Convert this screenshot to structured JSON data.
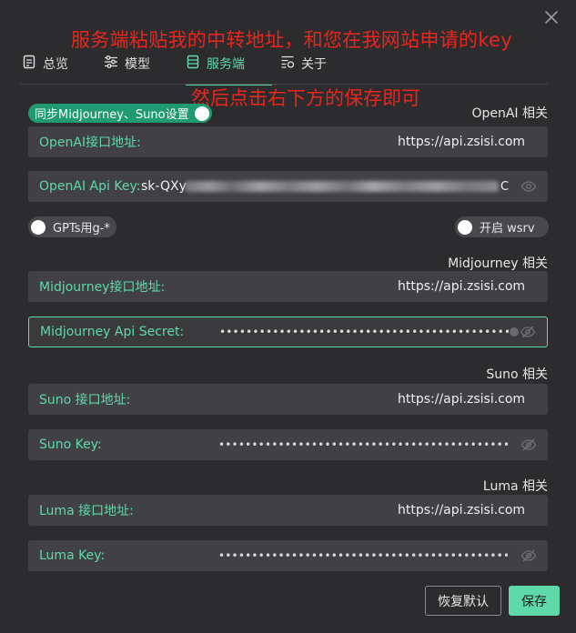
{
  "annotation": {
    "line1": "服务端粘贴我的中转地址，和您在我网站申请的key",
    "line2": "然后点击右下方的保存即可"
  },
  "tabs": [
    {
      "label": "总览",
      "icon": "summary-icon"
    },
    {
      "label": "模型",
      "icon": "sliders-icon"
    },
    {
      "label": "服务端",
      "icon": "server-list-icon",
      "active": true
    },
    {
      "label": "关于",
      "icon": "about-icon"
    }
  ],
  "sync_toggle": {
    "label": "同步Midjourney、Suno设置",
    "on": true
  },
  "openai": {
    "section": "OpenAI 相关",
    "url_label": "OpenAI接口地址:",
    "url_value": "https://api.zsisi.com",
    "key_label": "OpenAI Api Key:",
    "key_prefix": "sk-QXy",
    "key_suffix": "C"
  },
  "gpts_toggle": {
    "label": "GPTs用g-*",
    "on": false
  },
  "wsrv_toggle": {
    "label": "开启 wsrv",
    "on": false
  },
  "midjourney": {
    "section": "Midjourney 相关",
    "url_label": "Midjourney接口地址:",
    "url_value": "https://api.zsisi.com",
    "secret_label": "Midjourney Api Secret:",
    "secret_value": "••••••••••••••••••••••••••••••••••••••••••••••••"
  },
  "suno": {
    "section": "Suno 相关",
    "url_label": "Suno 接口地址:",
    "url_value": "https://api.zsisi.com",
    "key_label": "Suno Key:",
    "key_value": "••••••••••••••••••••••••••••••••••••••••••••••••"
  },
  "luma": {
    "section": "Luma 相关",
    "url_label": "Luma 接口地址:",
    "url_value": "https://api.zsisi.com",
    "key_label": "Luma Key:",
    "key_value": "••••••••••••••••••••••••••••••••••••••••••••••••"
  },
  "buttons": {
    "reset": "恢复默认",
    "save": "保存"
  },
  "colors": {
    "accent": "#5fd9a9",
    "toggle_on": "#1f9a72",
    "annotation": "#e8261c",
    "background": "#2c2c2f"
  }
}
